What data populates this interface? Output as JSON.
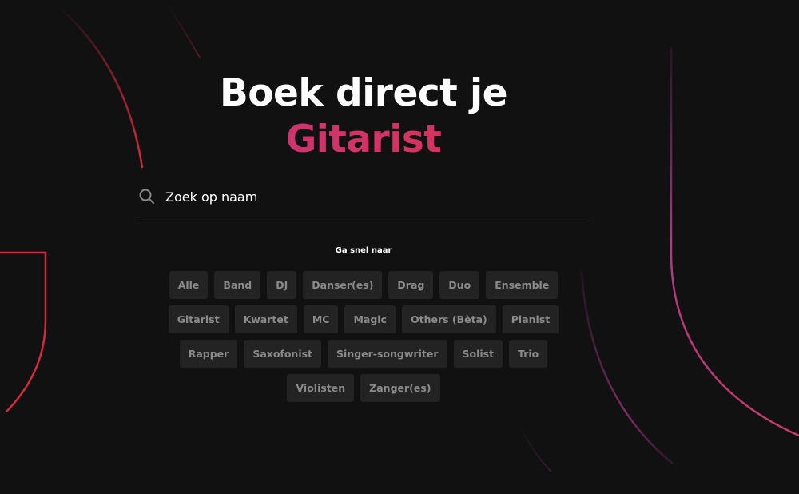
{
  "hero": {
    "line1": "Boek direct je",
    "line2": "Gitarist"
  },
  "search": {
    "placeholder": "Zoek op naam",
    "icon": "search-icon"
  },
  "quick": {
    "label": "Ga snel naar",
    "rows": [
      [
        "Alle",
        "Band",
        "DJ",
        "Danser(es)",
        "Drag",
        "Duo",
        "Ensemble"
      ],
      [
        "Gitarist",
        "Kwartet",
        "MC",
        "Magic",
        "Others (Bèta)",
        "Pianist"
      ],
      [
        "Rapper",
        "Saxofonist",
        "Singer-songwriter",
        "Solist",
        "Trio"
      ],
      [
        "Violisten",
        "Zanger(es)"
      ]
    ]
  },
  "colors": {
    "background": "#111111",
    "chip_bg": "#232323",
    "chip_text": "#8a8a8a",
    "accent_pink": "#d8325f",
    "accent_purple": "#b53a8c",
    "deco_red": "#d62a3c"
  }
}
